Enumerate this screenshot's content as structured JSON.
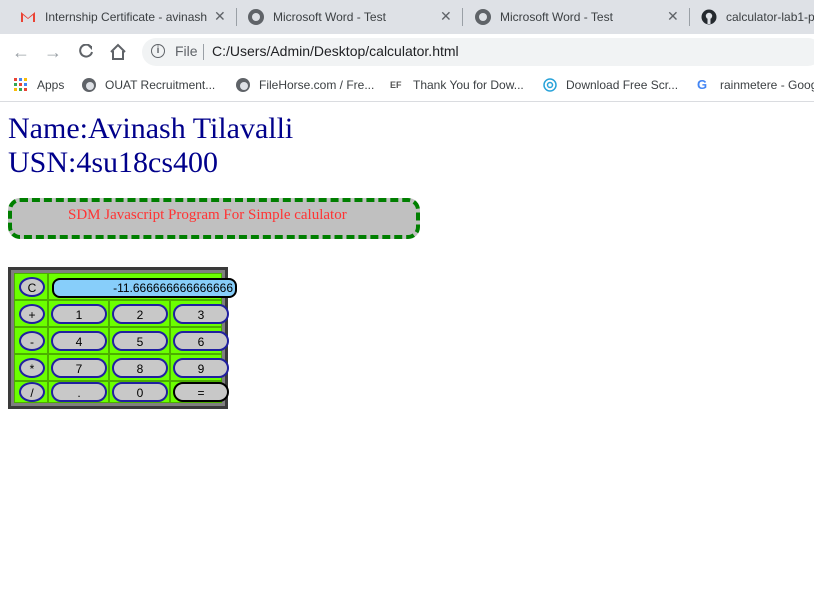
{
  "tabs": [
    {
      "title": "Internship Certificate - avinash",
      "icon": "gmail-icon"
    },
    {
      "title": "Microsoft Word - Test",
      "icon": "globe-icon"
    },
    {
      "title": "Microsoft Word - Test",
      "icon": "globe-icon"
    },
    {
      "title": "calculator-lab1-p",
      "icon": "github-icon"
    }
  ],
  "toolbar": {
    "file_label": "File",
    "url": "C:/Users/Admin/Desktop/calculator.html"
  },
  "bookmarks": [
    {
      "label": "Apps",
      "icon": "apps-grid-icon"
    },
    {
      "label": "OUAT Recruitment...",
      "icon": "globe-icon"
    },
    {
      "label": "FileHorse.com / Fre...",
      "icon": "globe-icon"
    },
    {
      "label": "Thank You for Dow...",
      "icon": "ef-icon"
    },
    {
      "label": "Download Free Scr...",
      "icon": "swirl-icon"
    },
    {
      "label": "rainmetere - Goog",
      "icon": "google-icon"
    }
  ],
  "page": {
    "name_line": "Name:Avinash Tilavalli",
    "usn_line": "USN:4su18cs400",
    "banner": "SDM Javascript Program For Simple calulator"
  },
  "calculator": {
    "display": "-11.666666666666666",
    "clear": "C",
    "rows": [
      {
        "op": "+",
        "keys": [
          "1",
          "2",
          "3"
        ]
      },
      {
        "op": "-",
        "keys": [
          "4",
          "5",
          "6"
        ]
      },
      {
        "op": "*",
        "keys": [
          "7",
          "8",
          "9"
        ]
      },
      {
        "op": "/",
        "keys": [
          ".",
          "0",
          "="
        ]
      }
    ]
  },
  "colors": {
    "heading": "#00008b",
    "banner_bg": "#c0c0c0",
    "banner_border": "#007f00",
    "banner_text": "#ff3333",
    "calc_bg": "#6bff00",
    "display_bg": "#87cefa",
    "key_border": "#2020a0"
  }
}
